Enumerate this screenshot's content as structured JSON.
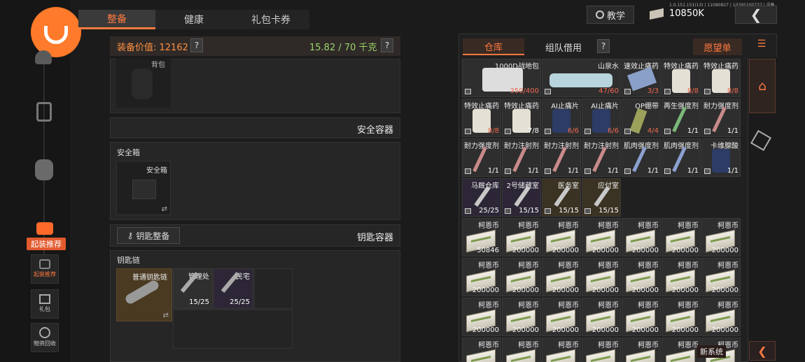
{
  "version_text": "1.0.151.151(13) | 11080827 | 10395200737 | 设备",
  "top_tabs": [
    "整备",
    "健康",
    "礼包卡券"
  ],
  "teach_label": "教学",
  "money": "10850K",
  "equip_value_label": "装备价值: 12162",
  "weight_label": "15.82 / 70 千克",
  "help": "?",
  "backpack_label": "背包",
  "secure_container_label": "安全容器",
  "secure_box_title": "安全箱",
  "secure_box_item": "安全箱",
  "key_manage_label": "钥匙整备",
  "key_container_label": "钥匙容器",
  "key_chain_title": "钥匙链",
  "key_slots": [
    {
      "name": "普通钥匙链",
      "count": ""
    },
    {
      "name": "管理处",
      "count": "15/25"
    },
    {
      "name": "民宅",
      "count": "25/25"
    }
  ],
  "sidebar": {
    "recommend_badge": "起装推荐",
    "recommend": "起装推荐",
    "gift": "礼包",
    "recycle": "物资回收"
  },
  "storage_tabs": {
    "warehouse": "仓库",
    "team_borrow": "组队借用",
    "wishlist": "愿望单"
  },
  "new_system": "新系统",
  "grid": [
    [
      {
        "n": "1000D战地包",
        "c": "350/400",
        "r": true,
        "k": "bag"
      },
      {
        "n": "山泉水",
        "c": "47/60",
        "r": true,
        "k": "water"
      },
      {
        "n": "速效止痛药",
        "c": "3/3",
        "r": true,
        "k": "pills"
      },
      {
        "n": "特效止痛药",
        "c": "8/8",
        "r": true,
        "k": "jar"
      },
      {
        "n": "特效止痛药",
        "c": "8/8",
        "r": true,
        "k": "jar"
      }
    ],
    [
      {
        "n": "特效止痛药",
        "c": "8/8",
        "r": true,
        "k": "jar"
      },
      {
        "n": "特效止痛药",
        "c": "7/8",
        "r": false,
        "k": "jar"
      },
      {
        "n": "AI止痛片",
        "c": "6/6",
        "r": true,
        "k": "bottle"
      },
      {
        "n": "AI止痛片",
        "c": "6/6",
        "r": true,
        "k": "bottle"
      },
      {
        "n": "OP绷带",
        "c": "4/4",
        "r": true,
        "k": "band"
      },
      {
        "n": "再生强度剂",
        "c": "1/1",
        "r": false,
        "k": "syr"
      },
      {
        "n": "耐力强度剂",
        "c": "1/1",
        "r": false,
        "k": "syrr"
      }
    ],
    [
      {
        "n": "耐力强度剂",
        "c": "1/1",
        "r": false,
        "k": "syrr"
      },
      {
        "n": "耐力注射剂",
        "c": "1/1",
        "r": false,
        "k": "syrr"
      },
      {
        "n": "耐力注射剂",
        "c": "1/1",
        "r": false,
        "k": "syrr"
      },
      {
        "n": "耐力注射剂",
        "c": "1/1",
        "r": false,
        "k": "syrr"
      },
      {
        "n": "肌肉强度剂",
        "c": "1/1",
        "r": false,
        "k": "syrb"
      },
      {
        "n": "肌肉强度剂",
        "c": "1/1",
        "r": false,
        "k": "syrb"
      },
      {
        "n": "卡维腺酸",
        "c": "1/1",
        "r": false,
        "k": "bottle"
      }
    ],
    [
      {
        "n": "马厩仓库",
        "c": "25/25",
        "r": false,
        "k": "keyp"
      },
      {
        "n": "2号储藏室",
        "c": "15/15",
        "r": false,
        "k": "keyp2"
      },
      {
        "n": "医务室",
        "c": "15/15",
        "r": false,
        "k": "keyg"
      },
      {
        "n": "应付室",
        "c": "15/15",
        "r": false,
        "k": "keyg"
      }
    ],
    [
      {
        "n": "柯恩币",
        "c": "50846"
      },
      {
        "n": "柯恩币",
        "c": "200000"
      },
      {
        "n": "柯恩币",
        "c": "200000"
      },
      {
        "n": "柯恩币",
        "c": "200000"
      },
      {
        "n": "柯恩币",
        "c": "200000"
      },
      {
        "n": "柯恩币",
        "c": "200000"
      },
      {
        "n": "柯恩币",
        "c": "200000"
      }
    ],
    [
      {
        "n": "柯恩币",
        "c": "200000"
      },
      {
        "n": "柯恩币",
        "c": "200000"
      },
      {
        "n": "柯恩币",
        "c": "200000"
      },
      {
        "n": "柯恩币",
        "c": "200000"
      },
      {
        "n": "柯恩币",
        "c": "200000"
      },
      {
        "n": "柯恩币",
        "c": "200000"
      },
      {
        "n": "柯恩币",
        "c": "200000"
      }
    ],
    [
      {
        "n": "柯恩币",
        "c": "200000"
      },
      {
        "n": "柯恩币",
        "c": "200000"
      },
      {
        "n": "柯恩币",
        "c": "200000"
      },
      {
        "n": "柯恩币",
        "c": "200000"
      },
      {
        "n": "柯恩币",
        "c": "200000"
      },
      {
        "n": "柯恩币",
        "c": "200000"
      },
      {
        "n": "柯恩币",
        "c": "200000"
      }
    ],
    [
      {
        "n": "柯恩币",
        "c": ""
      },
      {
        "n": "柯恩币",
        "c": ""
      },
      {
        "n": "柯恩币",
        "c": ""
      },
      {
        "n": "柯恩币",
        "c": ""
      },
      {
        "n": "柯恩币",
        "c": ""
      },
      {
        "n": "柯恩币",
        "c": ""
      },
      {
        "n": "柯恩币",
        "c": ""
      }
    ]
  ]
}
